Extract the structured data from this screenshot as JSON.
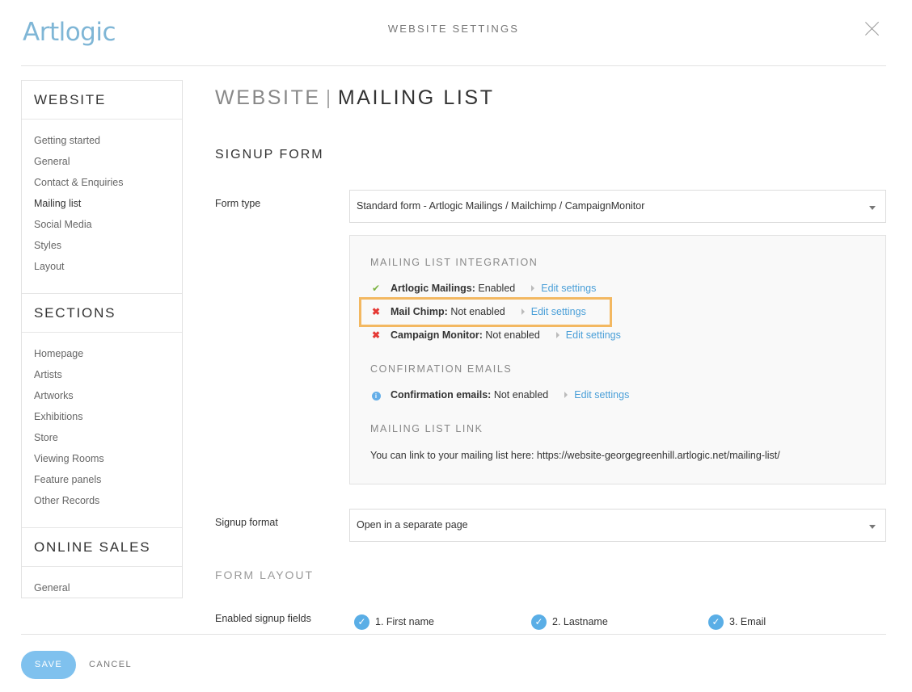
{
  "app": {
    "logo": "Artlogic",
    "window_title": "WEBSITE SETTINGS"
  },
  "sidebar": {
    "sections": [
      {
        "title": "WEBSITE",
        "items": [
          "Getting started",
          "General",
          "Contact & Enquiries",
          "Mailing list",
          "Social Media",
          "Styles",
          "Layout"
        ]
      },
      {
        "title": "SECTIONS",
        "items": [
          "Homepage",
          "Artists",
          "Artworks",
          "Exhibitions",
          "Store",
          "Viewing Rooms",
          "Feature panels",
          "Other Records"
        ]
      },
      {
        "title": "ONLINE SALES",
        "items": [
          "General"
        ]
      }
    ],
    "active_item": "Mailing list"
  },
  "page": {
    "crumb": "WEBSITE",
    "separator": "|",
    "title": "MAILING LIST"
  },
  "signup_form": {
    "heading": "SIGNUP FORM",
    "form_type_label": "Form type",
    "form_type_value": "Standard form - Artlogic Mailings / Mailchimp / CampaignMonitor",
    "integration_heading": "MAILING LIST INTEGRATION",
    "integrations": [
      {
        "name": "Artlogic Mailings:",
        "status": "Enabled",
        "icon": "check-icon",
        "link": "Edit settings"
      },
      {
        "name": "Mail Chimp:",
        "status": "Not enabled",
        "icon": "cross-icon",
        "link": "Edit settings"
      },
      {
        "name": "Campaign Monitor:",
        "status": "Not enabled",
        "icon": "cross-icon",
        "link": "Edit settings"
      }
    ],
    "confirmation_heading": "CONFIRMATION EMAILS",
    "confirmation": {
      "name": "Confirmation emails:",
      "status": "Not enabled",
      "icon": "info-icon",
      "link": "Edit settings"
    },
    "link_heading": "MAILING LIST LINK",
    "link_text": "You can link to your mailing list here: https://website-georgegreenhill.artlogic.net/mailing-list/",
    "signup_format_label": "Signup format",
    "signup_format_value": "Open in a separate page"
  },
  "form_layout": {
    "heading": "FORM LAYOUT",
    "fields_label": "Enabled signup fields",
    "fields": [
      "1. First name",
      "2. Lastname",
      "3. Email"
    ]
  },
  "footer": {
    "save": "SAVE",
    "cancel": "CANCEL"
  },
  "colors": {
    "accent": "#4a9fd8",
    "highlight": "#f3b861",
    "enabled": "#7cb342",
    "disabled": "#e53935",
    "save": "#7fc1ee"
  }
}
